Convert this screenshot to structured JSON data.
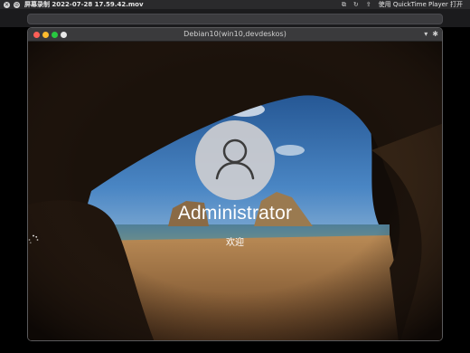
{
  "qt_bar": {
    "file_title": "屏幕录制 2022-07-28 17.59.42.mov",
    "open_with_label": "使用 QuickTime Player 打开",
    "icons": [
      "close-icon",
      "stop-icon",
      "pip-icon",
      "rotate-icon",
      "share-icon"
    ]
  },
  "vm_window": {
    "title": "Debian10(win10,devdeskos)",
    "controls": [
      "dropdown-icon",
      "gear-icon"
    ]
  },
  "login": {
    "username": "Administrator",
    "status_text": "欢迎"
  }
}
